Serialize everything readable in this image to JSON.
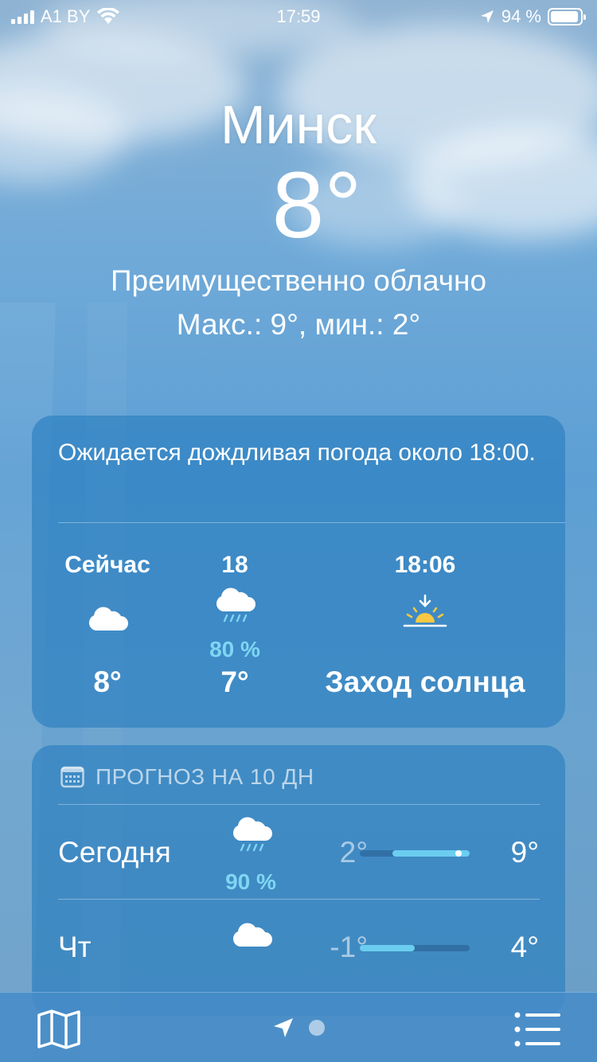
{
  "status_bar": {
    "carrier": "A1 BY",
    "time": "17:59",
    "battery_text": "94 %",
    "battery_level": 0.94
  },
  "header": {
    "city": "Минск",
    "temperature": "8°",
    "condition": "Преимущественно облачно",
    "hi_lo": "Макс.: 9°, мин.: 2°"
  },
  "hourly": {
    "summary": "Ожидается дождливая погода около 18:00.",
    "items": [
      {
        "label": "Сейчас",
        "icon": "cloud-icon",
        "precip": "",
        "value": "8°"
      },
      {
        "label": "18",
        "icon": "cloud-rain-icon",
        "precip": "80 %",
        "value": "7°"
      },
      {
        "label": "18:06",
        "icon": "sunset-icon",
        "precip": "",
        "value": "Заход солнца"
      }
    ]
  },
  "ten_day": {
    "title": "ПРОГНОЗ НА 10 ДН",
    "range_min": -1,
    "range_max": 9,
    "rows": [
      {
        "day": "Сегодня",
        "icon": "cloud-rain-icon",
        "precip": "90 %",
        "low": "2°",
        "high": "9°",
        "low_value": 2,
        "high_value": 9,
        "current_value": 8
      },
      {
        "day": "Чт",
        "icon": "cloud-icon",
        "precip": "",
        "low": "-1°",
        "high": "4°",
        "low_value": -1,
        "high_value": 4
      }
    ]
  },
  "colors": {
    "precip": "#7fd6f3",
    "sun": "#f7c843",
    "range_bar": "#6bcdf0"
  },
  "toolbar": {
    "left_icon": "map-icon",
    "center_icon": "location-arrow-icon",
    "right_icon": "list-icon"
  }
}
